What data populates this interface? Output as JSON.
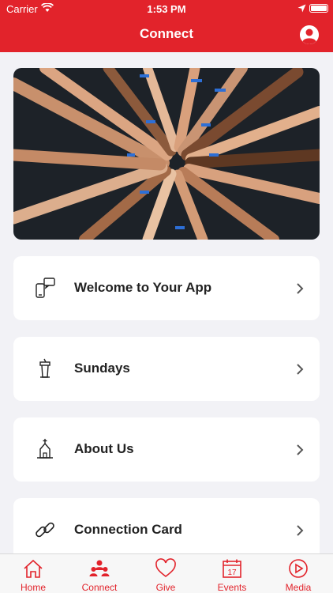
{
  "status_bar": {
    "carrier": "Carrier",
    "time": "1:53 PM"
  },
  "header": {
    "title": "Connect"
  },
  "hero": {
    "icon": "raised-hands-photo"
  },
  "cards": [
    {
      "label": "Welcome to Your App",
      "icon": "chat-phone-icon"
    },
    {
      "label": "Sundays",
      "icon": "pulpit-icon"
    },
    {
      "label": "About Us",
      "icon": "church-icon"
    },
    {
      "label": "Connection Card",
      "icon": "link-icon"
    }
  ],
  "tabs": [
    {
      "label": "Home",
      "icon": "home-icon"
    },
    {
      "label": "Connect",
      "icon": "people-icon"
    },
    {
      "label": "Give",
      "icon": "heart-icon"
    },
    {
      "label": "Events",
      "icon": "calendar-icon",
      "badge": "17"
    },
    {
      "label": "Media",
      "icon": "play-icon"
    }
  ],
  "colors": {
    "brand": "#e2232b",
    "background": "#f2f2f6",
    "card": "#ffffff"
  }
}
